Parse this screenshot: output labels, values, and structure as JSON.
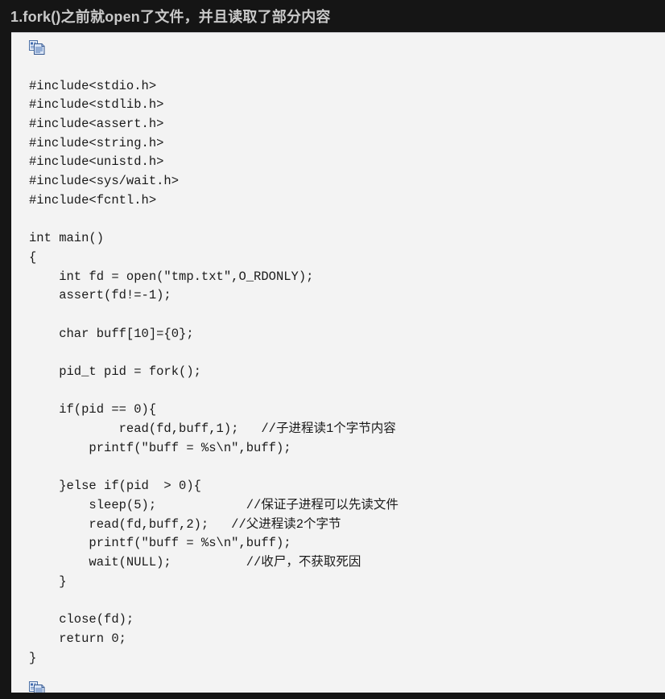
{
  "header": {
    "title": "1.fork()之前就open了文件，并且读取了部分内容"
  },
  "code_block": {
    "language": "c",
    "copy_icon_top": "copy-icon",
    "copy_icon_bottom": "copy-icon",
    "background_color": "#f3f3f3",
    "text_color": "#1a1a1a",
    "page_background_color": "#151515",
    "title_color": "#c9c9c9",
    "lines": [
      "#include<stdio.h>",
      "#include<stdlib.h>",
      "#include<assert.h>",
      "#include<string.h>",
      "#include<unistd.h>",
      "#include<sys/wait.h>",
      "#include<fcntl.h>",
      "",
      "int main()",
      "{",
      "    int fd = open(\"tmp.txt\",O_RDONLY);",
      "    assert(fd!=-1);",
      "",
      "    char buff[10]={0};",
      "",
      "    pid_t pid = fork();",
      "",
      "    if(pid == 0){",
      "            read(fd,buff,1);   //子进程读1个字节内容",
      "        printf(\"buff = %s\\n\",buff);",
      "",
      "    }else if(pid  > 0){",
      "        sleep(5);            //保证子进程可以先读文件",
      "        read(fd,buff,2);   //父进程读2个字节",
      "        printf(\"buff = %s\\n\",buff);",
      "        wait(NULL);          //收尸，不获取死因",
      "    }",
      "",
      "    close(fd);",
      "    return 0;",
      "}"
    ]
  }
}
